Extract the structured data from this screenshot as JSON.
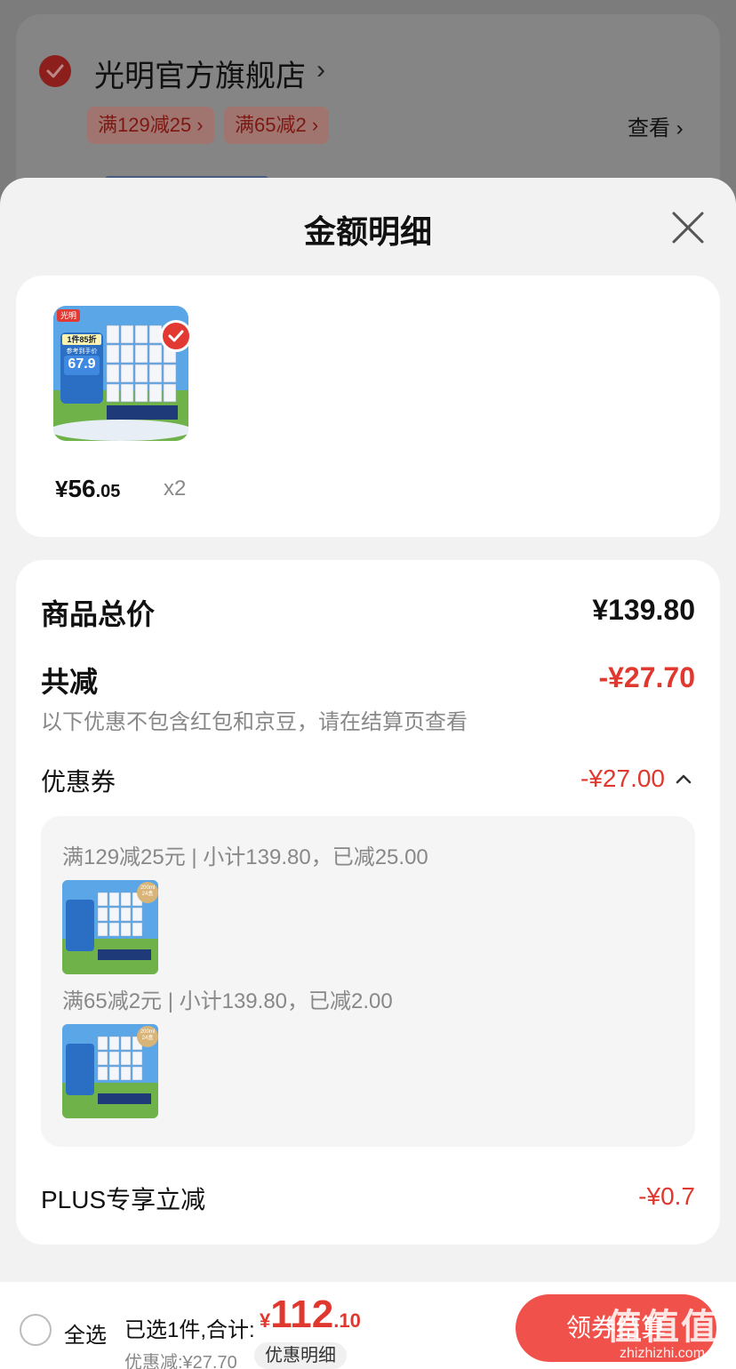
{
  "background_card": {
    "shop_name": "光明官方旗舰店",
    "promo_tags": [
      "满129减25 ›",
      "满65减2 ›"
    ],
    "view_label": "查看 ›"
  },
  "sheet": {
    "title": "金额明细"
  },
  "product": {
    "brand_tag": "光明",
    "img_badge": "1件85折",
    "img_subbadge": "参考到手价",
    "img_price": "67.9",
    "price_currency": "¥",
    "price_int": "56",
    "price_dec": ".05",
    "quantity": "x2"
  },
  "summary": {
    "total_label": "商品总价",
    "total_value": "¥139.80",
    "reduced_label": "共减",
    "reduced_value": "-¥27.70",
    "note": "以下优惠不包含红包和京豆，请在结算页查看",
    "coupon_label": "优惠券",
    "coupon_value": "-¥27.00",
    "coupons": [
      {
        "text": "满129减25元 | 小计139.80，已减25.00"
      },
      {
        "text": "满65减2元 | 小计139.80，已减2.00"
      }
    ],
    "coupon_thumb_volume": "200ml\n24盒",
    "plus_label": "PLUS专享立减",
    "plus_value": "-¥0.7"
  },
  "bottom_bar": {
    "select_all": "全选",
    "selected_text": "已选1件,合计:",
    "total_currency": "¥",
    "total_int": "112",
    "total_dec": ".10",
    "discount_text": "优惠减:¥27.70",
    "detail_label": "优惠明细",
    "coupon_button": "领券结算"
  },
  "watermark": {
    "text": "值值值",
    "url": "zhizhizhi.com"
  },
  "colors": {
    "accent_red": "#e0382f",
    "button_red": "#f0524b",
    "sky_blue": "#5ba6e6",
    "grass_green": "#6fb24a"
  }
}
